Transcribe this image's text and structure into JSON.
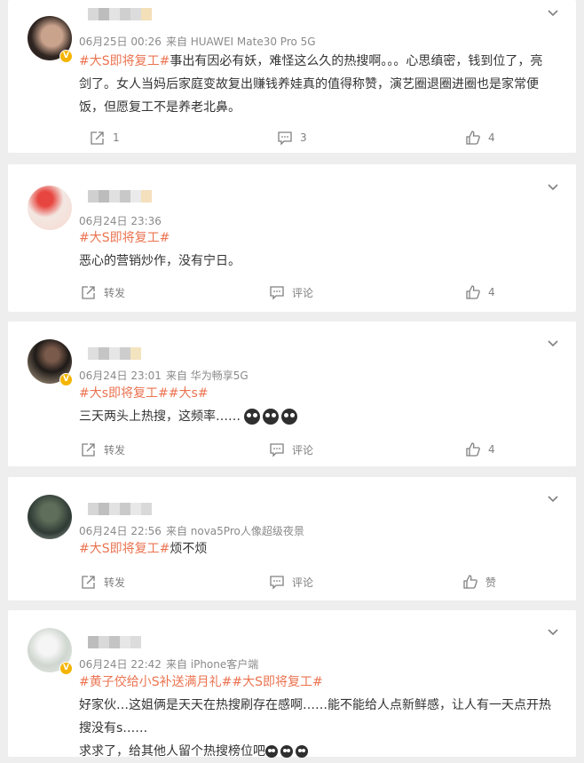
{
  "comments": [
    {
      "time": "06月25日 00:26",
      "source": "来自 HUAWEI Mate30 Pro 5G",
      "tags": [
        "#大S即将复工#"
      ],
      "text": "事出有因必有妖，难怪这么久的热搜啊。。。心思缜密，钱到位了，亮剑了。女人当妈后家庭变故复出赚钱养娃真的值得称赞，演艺圈退圈进圈也是家常便饭，但愿复工不是养老北鼻。",
      "forward": "1",
      "comment": "3",
      "like": "4"
    },
    {
      "time": "06月24日 23:36",
      "source": "",
      "tags": [
        "#大S即将复工#"
      ],
      "text": "恶心的营销炒作，没有宁日。",
      "forward": "转发",
      "comment": "评论",
      "like": "4"
    },
    {
      "time": "06月24日 23:01",
      "source": "来自 华为畅享5G",
      "tags": [
        "#大s即将复工#",
        "#大s#"
      ],
      "text": "三天两头上热搜，这频率……",
      "forward": "转发",
      "comment": "评论",
      "like": "4"
    },
    {
      "time": "06月24日 22:56",
      "source": "来自 nova5Pro人像超级夜景",
      "tags": [
        "#大S即将复工#"
      ],
      "text": "烦不烦",
      "forward": "转发",
      "comment": "评论",
      "like": "赞"
    },
    {
      "time": "06月24日 22:42",
      "source": "来自 iPhone客户端",
      "tags": [
        "#黄子佼给小S补送满月礼#",
        "#大S即将复工#"
      ],
      "text": "好家伙…这姐俩是天天在热搜刷存在感啊……能不能给人点新鲜感，让人有一天点开热搜没有s……",
      "text2": "求求了，给其他人留个热搜榜位吧"
    }
  ],
  "colors": {
    "tag": "#eb7350",
    "meta": "#8a8a8a",
    "verified": "#f4b400"
  },
  "icons": [
    "chevron-down-icon",
    "forward-icon",
    "comment-icon",
    "like-icon",
    "verified-badge-icon"
  ]
}
